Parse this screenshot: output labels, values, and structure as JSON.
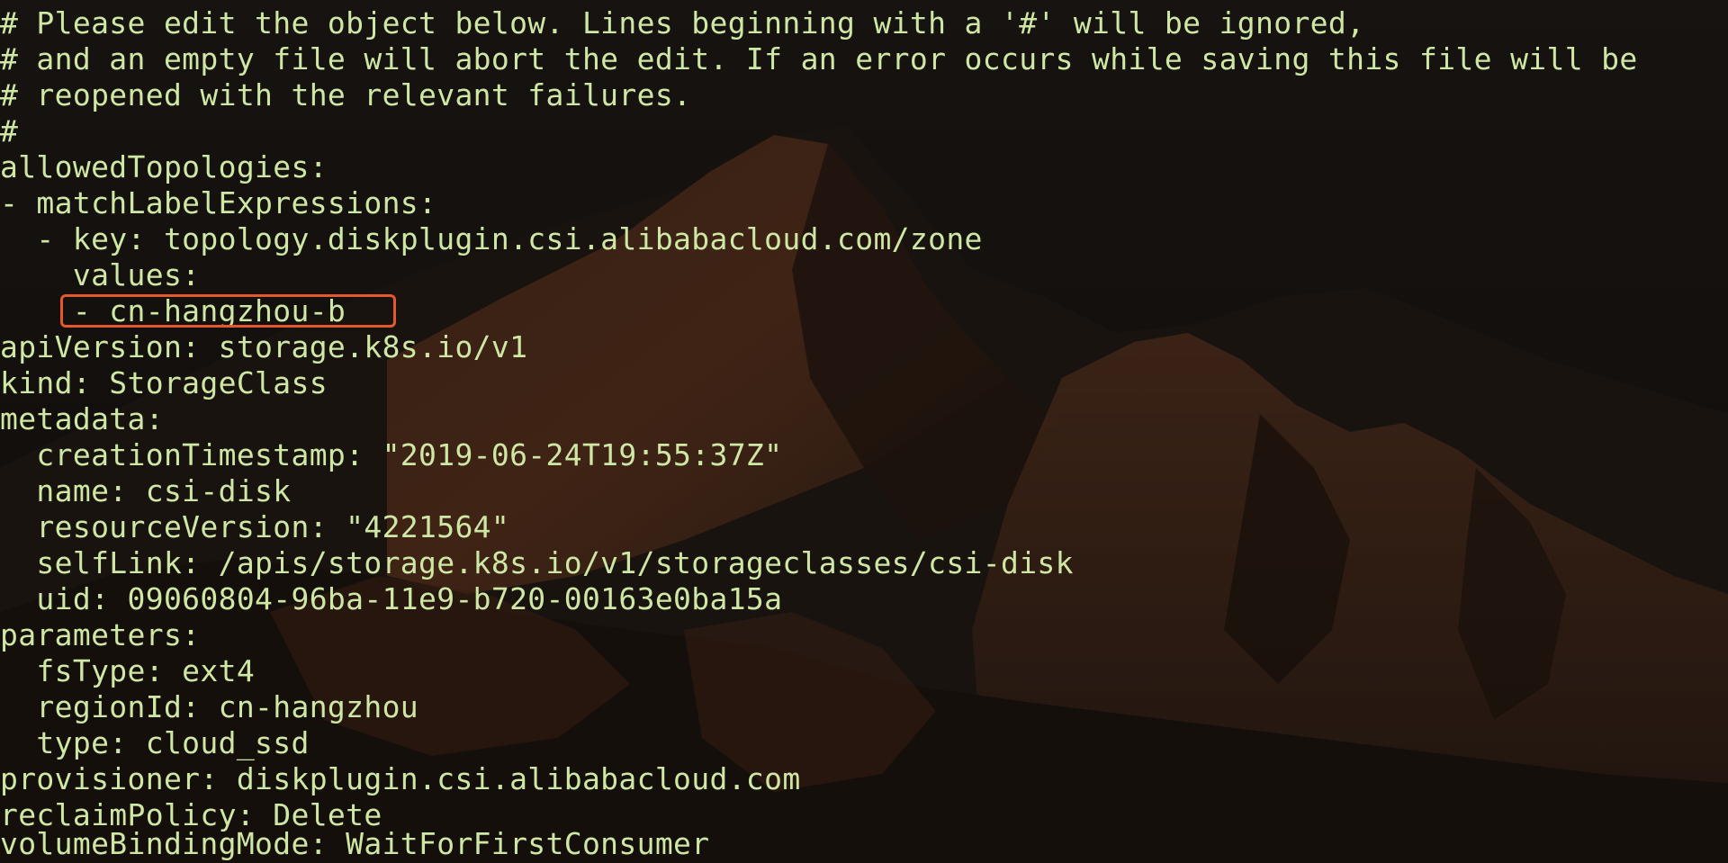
{
  "terminal": {
    "lines": [
      "# Please edit the object below. Lines beginning with a '#' will be ignored,",
      "# and an empty file will abort the edit. If an error occurs while saving this file will be",
      "# reopened with the relevant failures.",
      "#",
      "allowedTopologies:",
      "- matchLabelExpressions:",
      "  - key: topology.diskplugin.csi.alibabacloud.com/zone",
      "    values:",
      "    - cn-hangzhou-b",
      "apiVersion: storage.k8s.io/v1",
      "kind: StorageClass",
      "metadata:",
      "  creationTimestamp: \"2019-06-24T19:55:37Z\"",
      "  name: csi-disk",
      "  resourceVersion: \"4221564\"",
      "  selfLink: /apis/storage.k8s.io/v1/storageclasses/csi-disk",
      "  uid: 09060804-96ba-11e9-b720-00163e0ba15a",
      "parameters:",
      "  fsType: ext4",
      "  regionId: cn-hangzhou",
      "  type: cloud_ssd",
      "provisioner: diskplugin.csi.alibabacloud.com",
      "reclaimPolicy: Delete",
      "volumeBindingMode: WaitForFirstConsumer"
    ]
  },
  "colors": {
    "text": "#cfe7a4",
    "highlight": "#e5582c",
    "background": "#17130f"
  }
}
